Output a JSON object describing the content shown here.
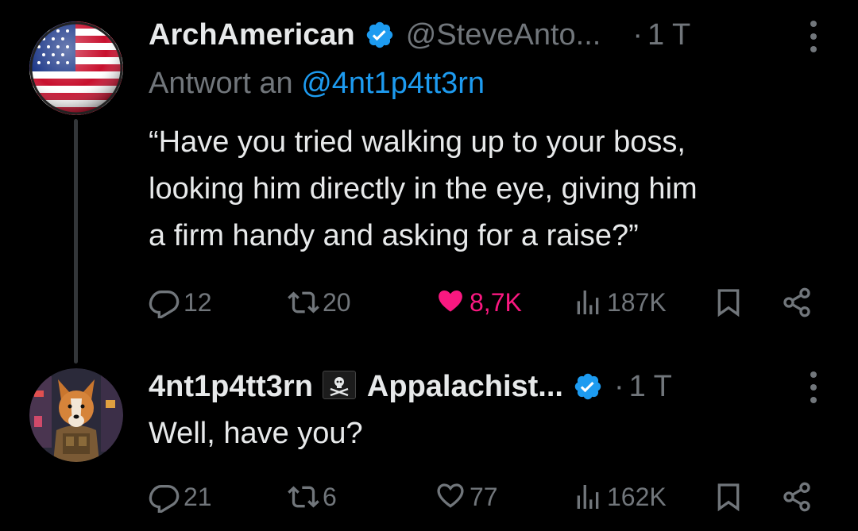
{
  "tweets": [
    {
      "display_name": "ArchAmerican",
      "handle": "@SteveAnto...",
      "separator": "·",
      "time": "1 T",
      "replying_prefix": "Antwort an",
      "replying_to": "@4nt1p4tt3rn",
      "text_lines": [
        "“Have you tried walking up to your boss,",
        "looking him directly in the eye, giving him",
        "a firm handy and asking for a raise?”"
      ],
      "replies": "12",
      "reposts": "20",
      "likes": "8,7K",
      "views": "187K",
      "liked": true
    },
    {
      "display_name": "4nt1p4tt3rn",
      "display_name_suffix": "Appalachist...",
      "separator": "·",
      "time": "1 T",
      "text_lines": [
        "Well, have you?"
      ],
      "replies": "21",
      "reposts": "6",
      "likes": "77",
      "views": "162K",
      "liked": false
    }
  ],
  "colors": {
    "background": "#000000",
    "text": "#e7e9ea",
    "muted": "#71767b",
    "link": "#1d9bf0",
    "like": "#f91880",
    "verified": "#1d9bf0"
  },
  "icons": {
    "avatar_1": "us-flag-avatar",
    "avatar_2": "dog-soldier-avatar",
    "verified": "verified-badge-icon",
    "emoji": "pirate-flag-emoji",
    "reply": "reply-icon",
    "repost": "repost-icon",
    "like": "heart-icon",
    "views": "views-icon",
    "bookmark": "bookmark-icon",
    "share": "share-icon",
    "more": "more-icon"
  }
}
